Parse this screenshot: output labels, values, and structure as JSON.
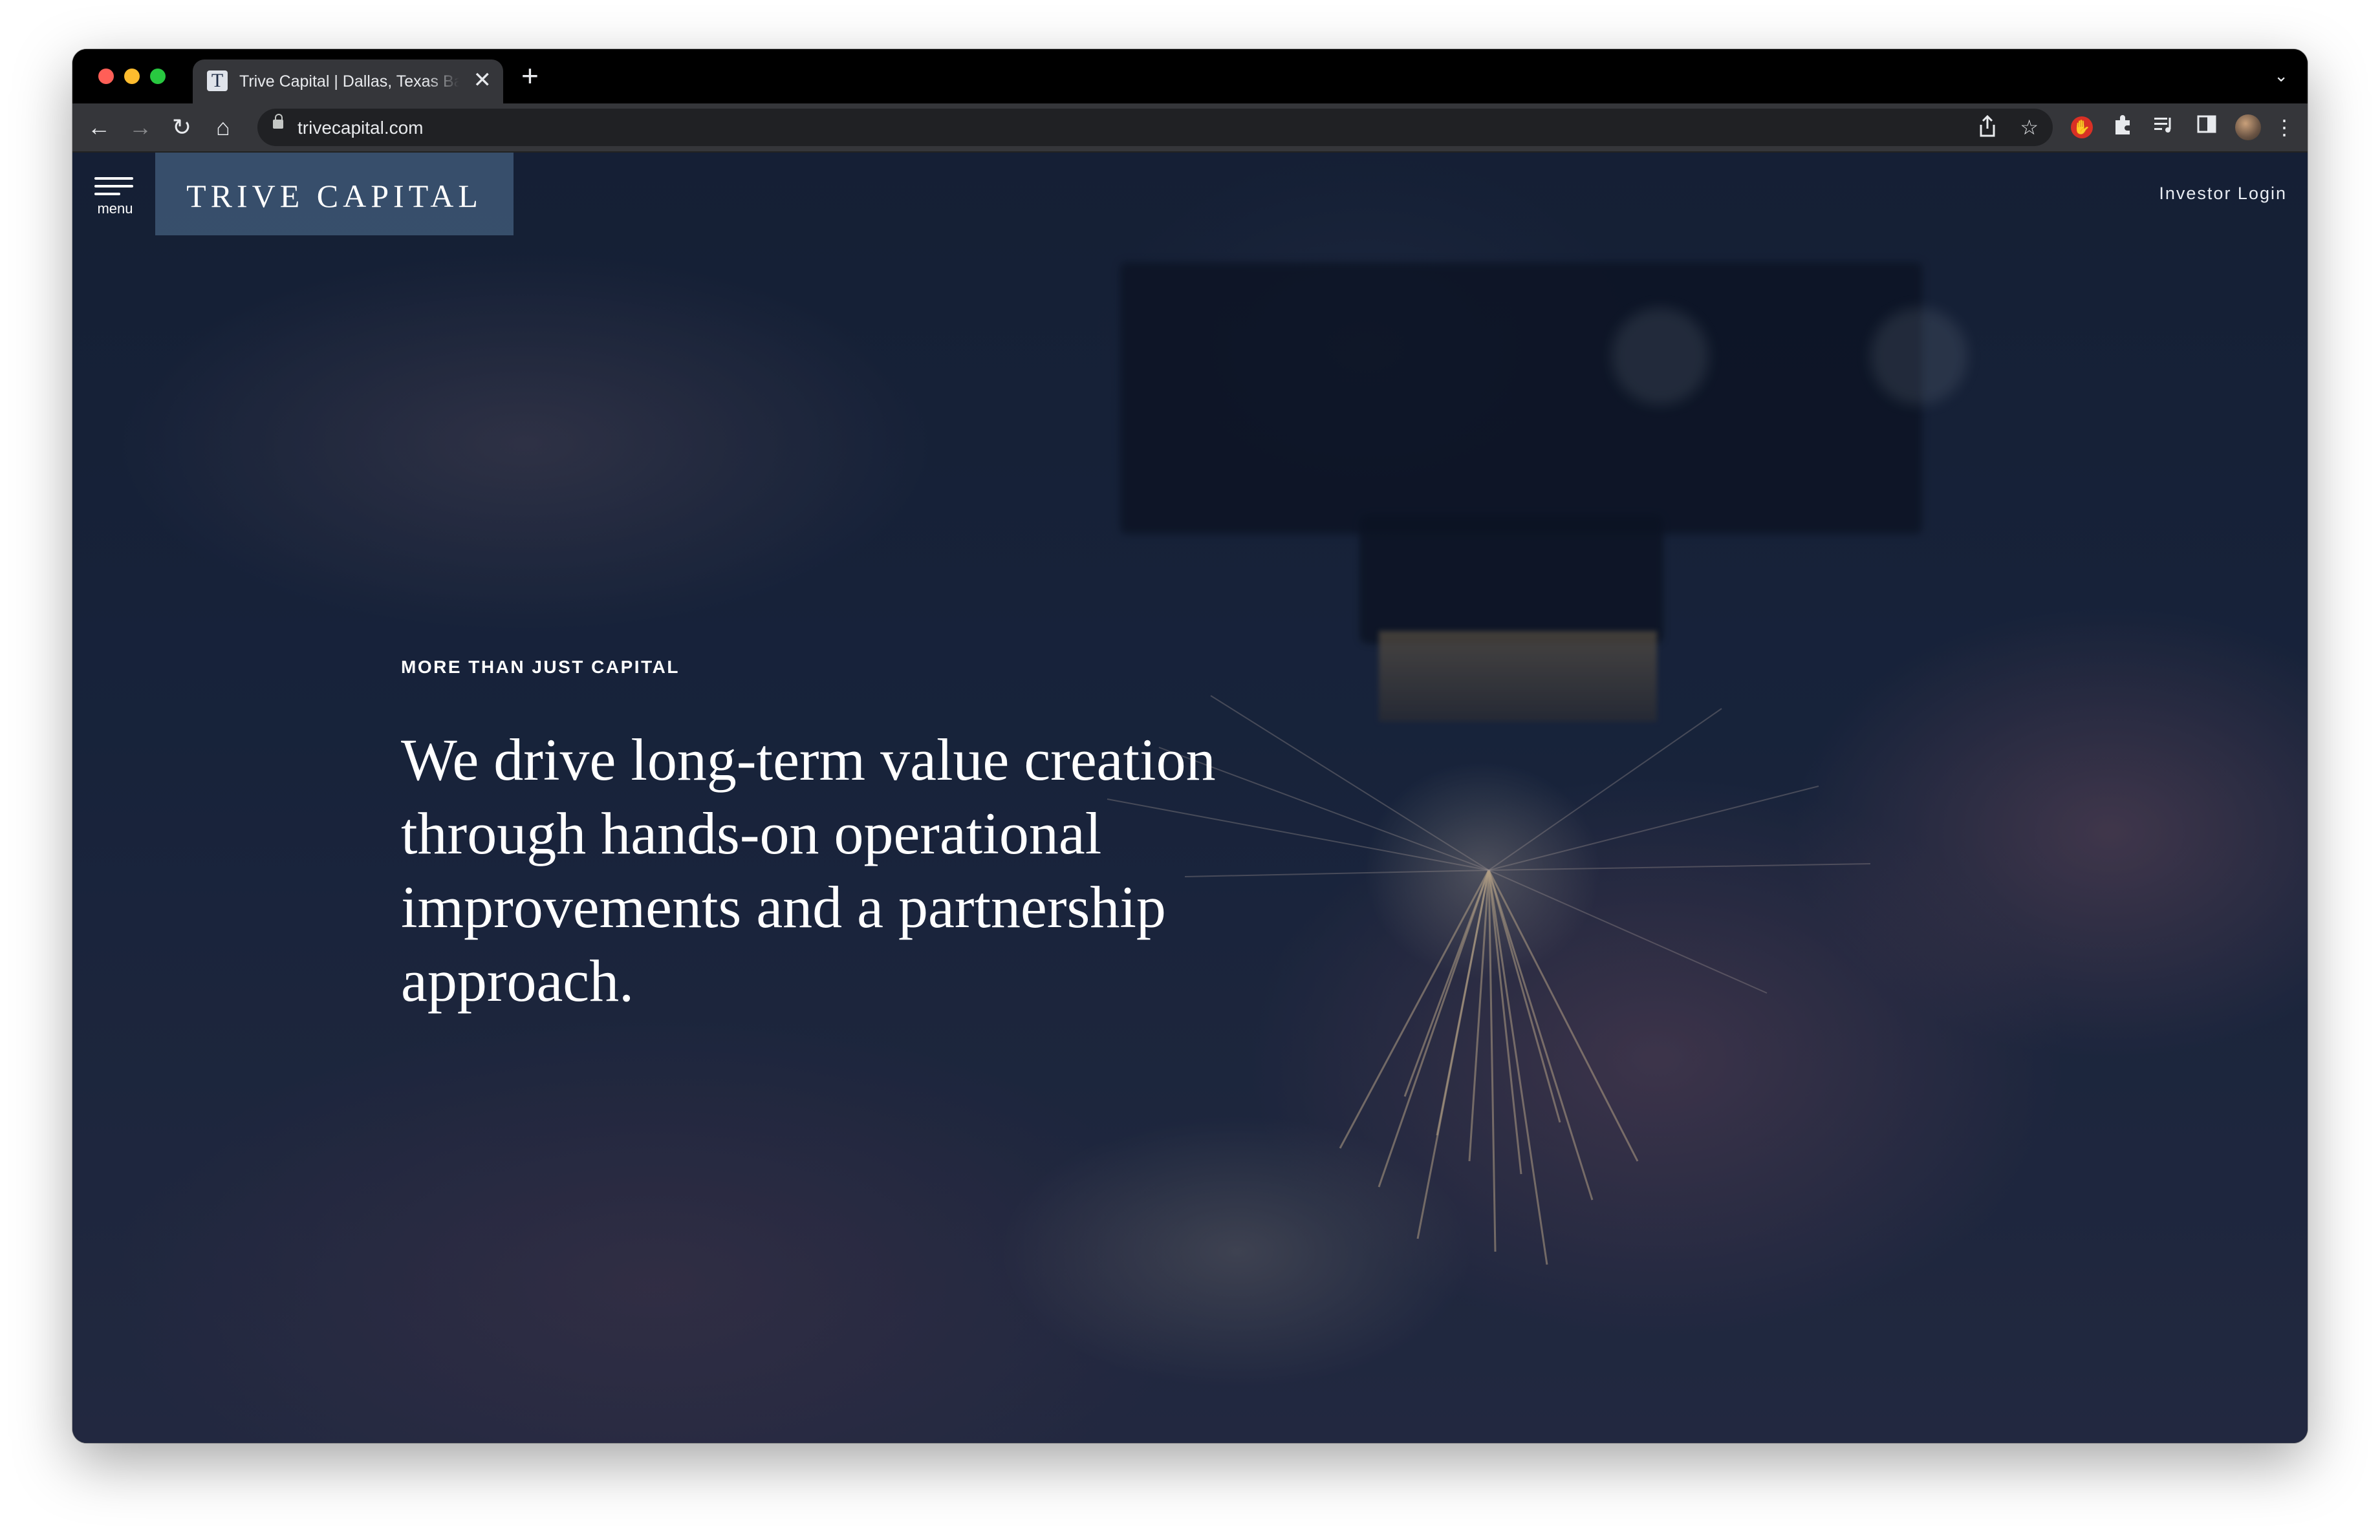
{
  "browser": {
    "tab": {
      "favicon_letter": "T",
      "title": "Trive Capital | Dallas, Texas Based Private Equity",
      "close_glyph": "✕"
    },
    "new_tab_glyph": "+",
    "tab_dropdown_glyph": "⌄",
    "address": {
      "url": "trivecapital.com"
    },
    "nav": {
      "back_glyph": "←",
      "forward_glyph": "→",
      "reload_glyph": "↻",
      "home_glyph": "⌂"
    },
    "toolbar_icons": [
      "share-icon",
      "star-icon",
      "adblock-icon",
      "extensions-icon",
      "media-control-icon",
      "side-panel-icon",
      "profile-avatar",
      "more-icon"
    ]
  },
  "site": {
    "menu_label": "menu",
    "logo_text": "TRIVE CAPITAL",
    "investor_login": "Investor Login",
    "hero": {
      "eyebrow": "MORE THAN JUST CAPITAL",
      "headline_lines": [
        "We drive long-term value creation",
        "through hands-on operational",
        "improvements and a partnership",
        "approach."
      ]
    }
  },
  "colors": {
    "logo_box": "#3c5573",
    "page_dark": "#172238",
    "text": "#ffffff"
  }
}
